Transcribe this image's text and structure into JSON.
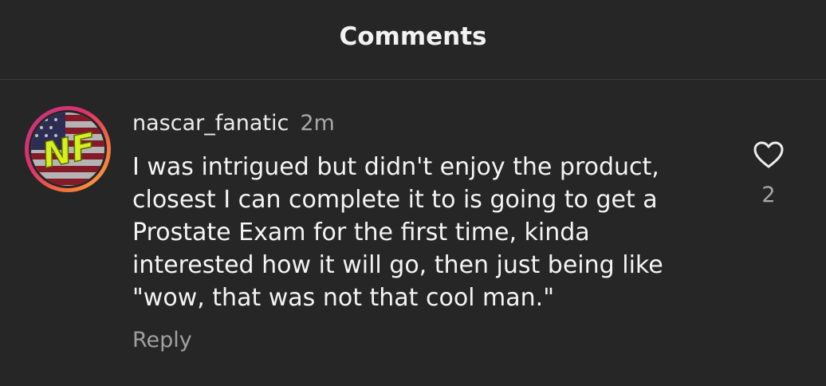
{
  "header": {
    "title": "Comments"
  },
  "comment": {
    "username": "nascar_fanatic",
    "time": "2m",
    "text_lines": [
      "I was intrigued but didn't enjoy the product,",
      "closest I can complete it to is going to get a",
      "Prostate Exam for the first time, kinda",
      "interested how it will go, then just being like",
      "\"wow,  that was not that cool man.\""
    ],
    "reply_label": "Reply",
    "like_icon": "heart-outline-icon",
    "like_count": "2",
    "avatar": {
      "initials": "NF",
      "ring_colors": [
        "#c13584",
        "#e1306c",
        "#f77737",
        "#fcaf45"
      ],
      "initials_color": "#d4f01e"
    }
  }
}
